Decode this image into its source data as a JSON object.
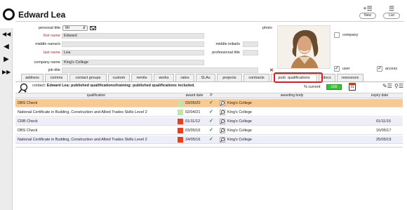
{
  "window": {
    "title": "Edward Lea"
  },
  "toolbar": {
    "new_label": "New",
    "list_label": "List"
  },
  "form": {
    "personal_title_label": "personal title",
    "personal_title_value": "Mr",
    "first_name_label": "first name",
    "first_name_value": "Edward",
    "middle_names_label": "middle name/s",
    "middle_names_value": "",
    "middle_initials_label": "middle initial/s",
    "last_name_label": "last name",
    "last_name_value": "Lea",
    "professional_title_label": "professional title",
    "company_name_label": "company name",
    "company_name_value": "King's College",
    "job_title_label": "job title",
    "job_title_value": "",
    "photo_label": "photo",
    "company_checkbox_label": "company",
    "user_checkbox_label": "user",
    "access_checkbox_label": "access"
  },
  "tabs": [
    {
      "label": "address"
    },
    {
      "label": "comms"
    },
    {
      "label": "contact groups"
    },
    {
      "label": "custom"
    },
    {
      "label": "remits"
    },
    {
      "label": "works"
    },
    {
      "label": "rates"
    },
    {
      "label": "SLAs"
    },
    {
      "label": "projects"
    },
    {
      "label": "contracts"
    },
    {
      "label": "publ. qualifications"
    },
    {
      "label": "docs"
    },
    {
      "label": "resources"
    }
  ],
  "active_tab": "publ. qualifications",
  "filter": {
    "contact_prefix": "contact:",
    "contact_text": "Edward Lea: published qualifications/training: published qualifications included.",
    "current_label": "% current",
    "current_value": "100",
    "calendar_number": "31"
  },
  "table": {
    "headers": {
      "qualification": "qualification",
      "award_date": "award date",
      "p": "P",
      "awarding_body": "awarding body",
      "expiry_date": "expiry date"
    },
    "rows": [
      {
        "qualification": "DBS Check",
        "status_color": "#bfe6a8",
        "award_date": "03/05/20",
        "awarding_body": "King's College",
        "expiry_date": "",
        "row_bg": "#fbc98e"
      },
      {
        "qualification": "National Certificate in Building, Construction and Allied Trades Skills Level 2",
        "status_color": "#bfe6a8",
        "award_date": "02/04/21",
        "awarding_body": "King's College",
        "expiry_date": "",
        "row_bg": "#ffffff"
      },
      {
        "qualification": "CRB Check",
        "status_color": "#e8401f",
        "award_date": "01/11/12",
        "awarding_body": "King's College",
        "expiry_date": "01/11/15",
        "row_bg": "#eeeefa"
      },
      {
        "qualification": "DBS Check",
        "status_color": "#e8401f",
        "award_date": "03/05/16",
        "awarding_body": "King's College",
        "expiry_date": "16/05/17",
        "row_bg": "#ffffff"
      },
      {
        "qualification": "National Certificate in Building, Construction and Allied Trades Skills Level 2",
        "status_color": "#e8401f",
        "award_date": "24/05/16",
        "awarding_body": "King's College",
        "expiry_date": "25/05/19",
        "row_bg": "#eeeefa"
      }
    ]
  },
  "colors": {
    "highlight": "#e31c1c",
    "current_green": "#37c437",
    "required_label": "#cc2020"
  }
}
